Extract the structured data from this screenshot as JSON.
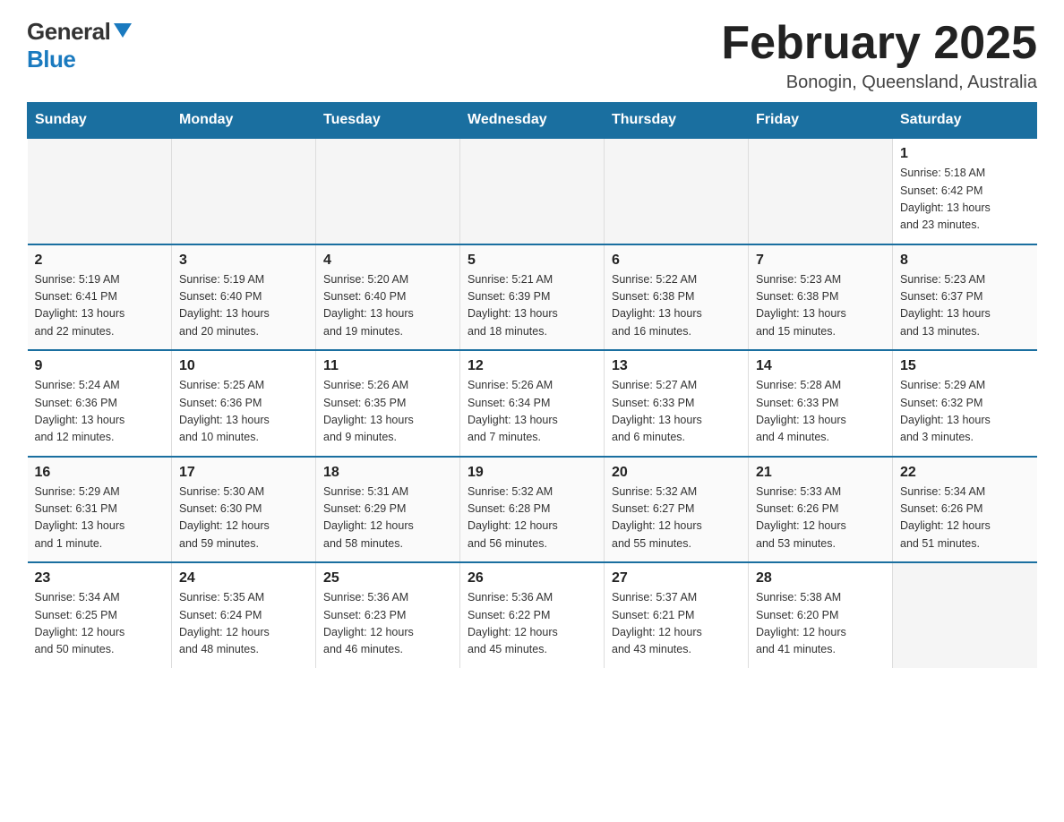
{
  "logo": {
    "general": "General",
    "blue": "Blue"
  },
  "header": {
    "title": "February 2025",
    "subtitle": "Bonogin, Queensland, Australia"
  },
  "weekdays": [
    "Sunday",
    "Monday",
    "Tuesday",
    "Wednesday",
    "Thursday",
    "Friday",
    "Saturday"
  ],
  "weeks": [
    [
      {
        "day": "",
        "info": ""
      },
      {
        "day": "",
        "info": ""
      },
      {
        "day": "",
        "info": ""
      },
      {
        "day": "",
        "info": ""
      },
      {
        "day": "",
        "info": ""
      },
      {
        "day": "",
        "info": ""
      },
      {
        "day": "1",
        "info": "Sunrise: 5:18 AM\nSunset: 6:42 PM\nDaylight: 13 hours\nand 23 minutes."
      }
    ],
    [
      {
        "day": "2",
        "info": "Sunrise: 5:19 AM\nSunset: 6:41 PM\nDaylight: 13 hours\nand 22 minutes."
      },
      {
        "day": "3",
        "info": "Sunrise: 5:19 AM\nSunset: 6:40 PM\nDaylight: 13 hours\nand 20 minutes."
      },
      {
        "day": "4",
        "info": "Sunrise: 5:20 AM\nSunset: 6:40 PM\nDaylight: 13 hours\nand 19 minutes."
      },
      {
        "day": "5",
        "info": "Sunrise: 5:21 AM\nSunset: 6:39 PM\nDaylight: 13 hours\nand 18 minutes."
      },
      {
        "day": "6",
        "info": "Sunrise: 5:22 AM\nSunset: 6:38 PM\nDaylight: 13 hours\nand 16 minutes."
      },
      {
        "day": "7",
        "info": "Sunrise: 5:23 AM\nSunset: 6:38 PM\nDaylight: 13 hours\nand 15 minutes."
      },
      {
        "day": "8",
        "info": "Sunrise: 5:23 AM\nSunset: 6:37 PM\nDaylight: 13 hours\nand 13 minutes."
      }
    ],
    [
      {
        "day": "9",
        "info": "Sunrise: 5:24 AM\nSunset: 6:36 PM\nDaylight: 13 hours\nand 12 minutes."
      },
      {
        "day": "10",
        "info": "Sunrise: 5:25 AM\nSunset: 6:36 PM\nDaylight: 13 hours\nand 10 minutes."
      },
      {
        "day": "11",
        "info": "Sunrise: 5:26 AM\nSunset: 6:35 PM\nDaylight: 13 hours\nand 9 minutes."
      },
      {
        "day": "12",
        "info": "Sunrise: 5:26 AM\nSunset: 6:34 PM\nDaylight: 13 hours\nand 7 minutes."
      },
      {
        "day": "13",
        "info": "Sunrise: 5:27 AM\nSunset: 6:33 PM\nDaylight: 13 hours\nand 6 minutes."
      },
      {
        "day": "14",
        "info": "Sunrise: 5:28 AM\nSunset: 6:33 PM\nDaylight: 13 hours\nand 4 minutes."
      },
      {
        "day": "15",
        "info": "Sunrise: 5:29 AM\nSunset: 6:32 PM\nDaylight: 13 hours\nand 3 minutes."
      }
    ],
    [
      {
        "day": "16",
        "info": "Sunrise: 5:29 AM\nSunset: 6:31 PM\nDaylight: 13 hours\nand 1 minute."
      },
      {
        "day": "17",
        "info": "Sunrise: 5:30 AM\nSunset: 6:30 PM\nDaylight: 12 hours\nand 59 minutes."
      },
      {
        "day": "18",
        "info": "Sunrise: 5:31 AM\nSunset: 6:29 PM\nDaylight: 12 hours\nand 58 minutes."
      },
      {
        "day": "19",
        "info": "Sunrise: 5:32 AM\nSunset: 6:28 PM\nDaylight: 12 hours\nand 56 minutes."
      },
      {
        "day": "20",
        "info": "Sunrise: 5:32 AM\nSunset: 6:27 PM\nDaylight: 12 hours\nand 55 minutes."
      },
      {
        "day": "21",
        "info": "Sunrise: 5:33 AM\nSunset: 6:26 PM\nDaylight: 12 hours\nand 53 minutes."
      },
      {
        "day": "22",
        "info": "Sunrise: 5:34 AM\nSunset: 6:26 PM\nDaylight: 12 hours\nand 51 minutes."
      }
    ],
    [
      {
        "day": "23",
        "info": "Sunrise: 5:34 AM\nSunset: 6:25 PM\nDaylight: 12 hours\nand 50 minutes."
      },
      {
        "day": "24",
        "info": "Sunrise: 5:35 AM\nSunset: 6:24 PM\nDaylight: 12 hours\nand 48 minutes."
      },
      {
        "day": "25",
        "info": "Sunrise: 5:36 AM\nSunset: 6:23 PM\nDaylight: 12 hours\nand 46 minutes."
      },
      {
        "day": "26",
        "info": "Sunrise: 5:36 AM\nSunset: 6:22 PM\nDaylight: 12 hours\nand 45 minutes."
      },
      {
        "day": "27",
        "info": "Sunrise: 5:37 AM\nSunset: 6:21 PM\nDaylight: 12 hours\nand 43 minutes."
      },
      {
        "day": "28",
        "info": "Sunrise: 5:38 AM\nSunset: 6:20 PM\nDaylight: 12 hours\nand 41 minutes."
      },
      {
        "day": "",
        "info": ""
      }
    ]
  ]
}
